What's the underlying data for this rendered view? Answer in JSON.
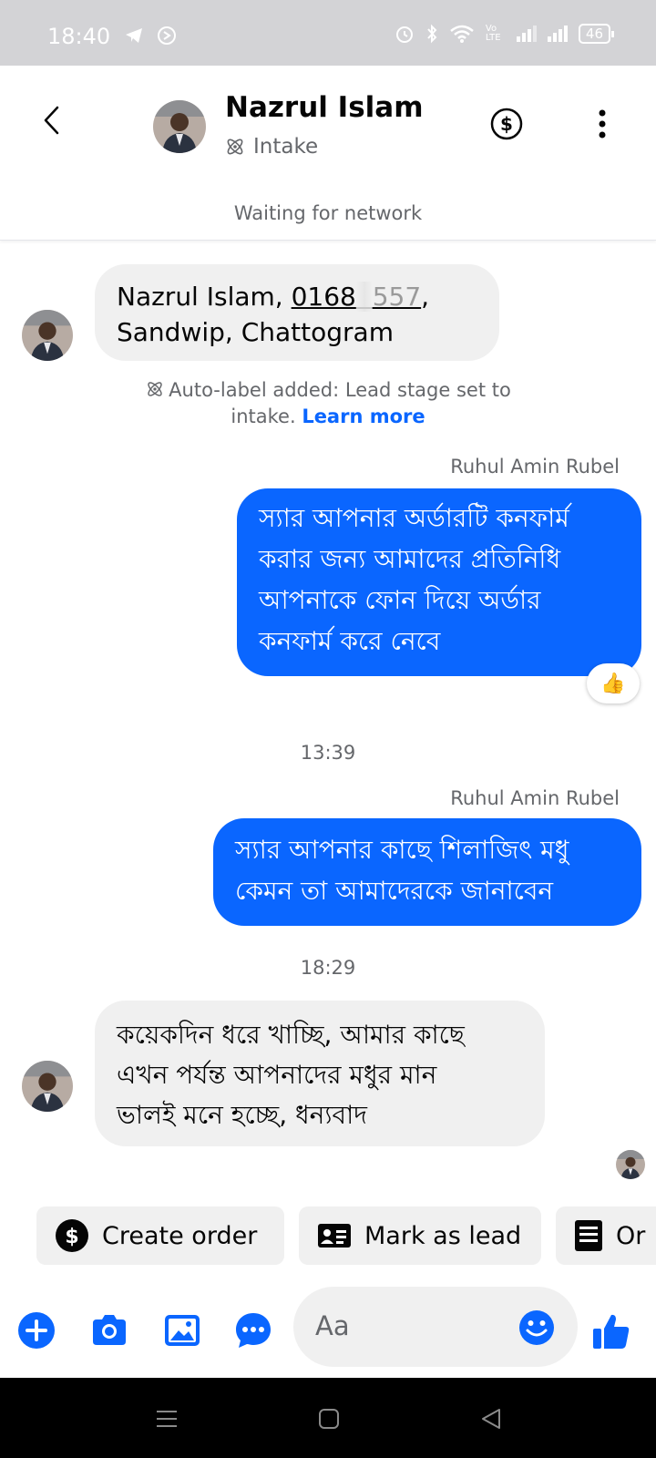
{
  "status_bar": {
    "time": "18:40",
    "battery": "46",
    "volte": "Vo LTE"
  },
  "header": {
    "contact_name": "Nazrul Islam",
    "stage_label": "Intake",
    "network_status": "Waiting for network"
  },
  "messages": {
    "m1": {
      "line1_prefix": "Nazrul Islam, ",
      "phone_visible_start": "0168",
      "phone_blurred": "  ",
      "phone_visible_end": "557",
      "phone_suffix": ",",
      "line2": "Sandwip, Chattogram"
    },
    "system_note": {
      "text": "Auto-label added: Lead stage set to intake.",
      "link": "Learn more"
    },
    "m2": {
      "sender": "Ruhul Amin Rubel",
      "lines": [
        "স্যার আপনার অর্ডারটি কনফার্ম",
        "করার জন্য আমাদের প্রতিনিধি",
        "আপনাকে ফোন দিয়ে অর্ডার",
        "কনফার্ম করে নেবে"
      ],
      "reaction": "👍"
    },
    "time1": "13:39",
    "m3": {
      "sender": "Ruhul Amin Rubel",
      "lines": [
        "স্যার আপনার কাছে শিলাজিৎ মধু",
        "কেমন তা আমাদেরকে জানাবেন"
      ]
    },
    "time2": "18:29",
    "m4": {
      "lines": [
        "কয়েকদিন ধরে খাচ্ছি, আমার কাছে",
        "এখন পর্যন্ত আপনাদের মধুর মান",
        "ভালই মনে হচ্ছে, ধন্যবাদ"
      ]
    }
  },
  "quick_actions": [
    {
      "label": "Create order",
      "icon": "dollar-circle-icon"
    },
    {
      "label": "Mark as lead",
      "icon": "contact-card-icon"
    },
    {
      "label": "Or",
      "icon": "orders-list-icon"
    }
  ],
  "composer": {
    "placeholder": "Aa"
  },
  "colors": {
    "accent": "#0a66ff",
    "incoming_bubble": "#f0f0f0",
    "secondary_text": "#65676b"
  }
}
